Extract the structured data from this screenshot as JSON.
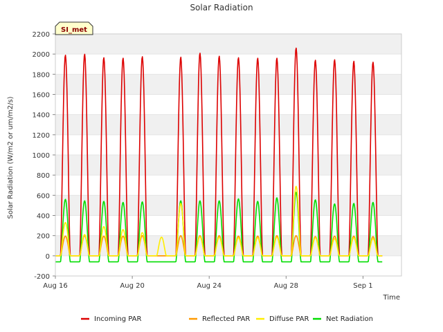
{
  "chart_data": {
    "type": "line",
    "title": "Solar Radiation",
    "xlabel": "Time",
    "ylabel": "Solar Radiation (W/m2 or um/m2/s)",
    "badge": "SI_met",
    "xlim": [
      0,
      18
    ],
    "ylim": [
      -200,
      2200
    ],
    "x_ticks": [
      {
        "x": 0,
        "label": "Aug 16"
      },
      {
        "x": 4,
        "label": "Aug 20"
      },
      {
        "x": 8,
        "label": "Aug 24"
      },
      {
        "x": 12,
        "label": "Aug 28"
      },
      {
        "x": 16,
        "label": "Sep 1"
      }
    ],
    "y_ticks": [
      -200,
      0,
      200,
      400,
      600,
      800,
      1000,
      1200,
      1400,
      1600,
      1800,
      2000,
      2200
    ],
    "grid": "horizontal bands",
    "legend_position": "bottom",
    "series": [
      {
        "name": "Incoming PAR",
        "color": "#dd0000",
        "daily_peaks": [
          1990,
          2000,
          1965,
          1960,
          1975,
          null,
          1970,
          2010,
          1980,
          1965,
          1960,
          1960,
          2060,
          1940,
          1945,
          1930,
          1920
        ],
        "night_value": 0
      },
      {
        "name": "Reflected PAR",
        "color": "#ff9900",
        "daily_peaks": [
          195,
          200,
          195,
          195,
          200,
          0,
          200,
          200,
          200,
          195,
          195,
          200,
          200,
          190,
          195,
          195,
          190
        ],
        "night_value": 0
      },
      {
        "name": "Diffuse PAR",
        "color": "#ffee00",
        "daily_peaks": [
          330,
          210,
          290,
          260,
          230,
          185,
          520,
          190,
          185,
          180,
          180,
          185,
          690,
          180,
          170,
          180,
          170
        ],
        "night_value": 0
      },
      {
        "name": "Net Radiation",
        "color": "#00dd00",
        "daily_peaks": [
          560,
          545,
          540,
          530,
          535,
          null,
          545,
          545,
          545,
          565,
          540,
          575,
          630,
          555,
          515,
          520,
          530
        ],
        "night_value": -60
      }
    ]
  }
}
